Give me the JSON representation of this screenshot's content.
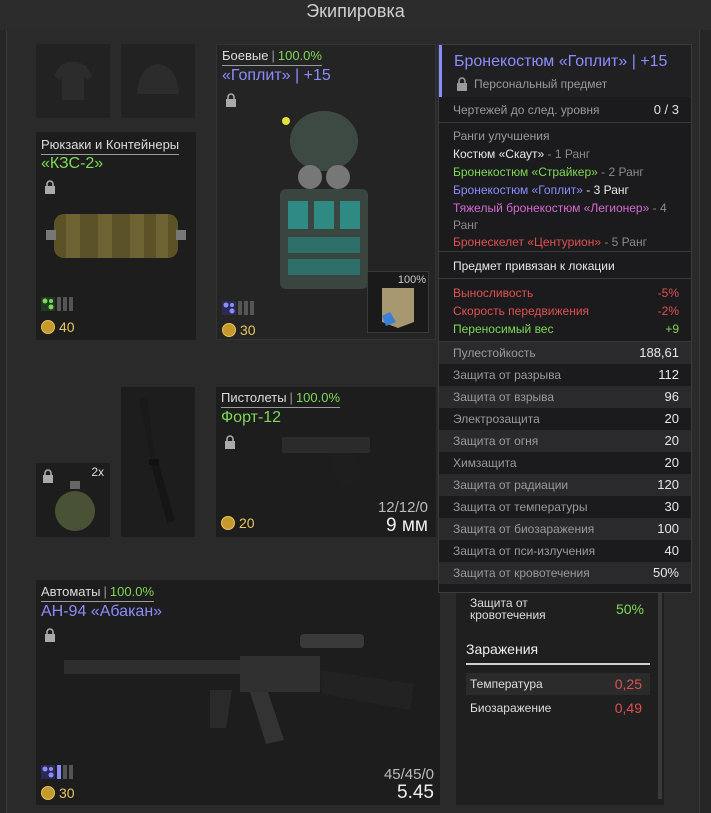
{
  "window": {
    "title": "Экипировка"
  },
  "slots": {
    "backpack": {
      "category": "Рюкзаки и Контейнеры",
      "name": "«КЗС-2»",
      "price": "40"
    },
    "armor": {
      "category": "Боевые",
      "condition": "100.0%",
      "name": "«Гоплит» | +15",
      "price": "30",
      "plate_durability": "100%"
    },
    "pistol": {
      "category": "Пистолеты",
      "condition": "100.0%",
      "name": "Форт-12",
      "price": "20",
      "ammo": "12/12/0",
      "caliber": "9 мм"
    },
    "grenade": {
      "count": "2x"
    },
    "rifle": {
      "category": "Автоматы",
      "condition": "100.0%",
      "name": "АН-94 «Абакан»",
      "price": "30",
      "ammo": "45/45/0",
      "caliber": "5.45"
    }
  },
  "tooltip": {
    "title": "Бронекостюм «Гоплит» | +15",
    "subtitle": "Персональный предмет",
    "blueprints_label": "Чертежей до след. уровня",
    "blueprints_value": "0 / 3",
    "ranks_header": "Ранги улучшения",
    "ranks": [
      {
        "name": "Костюм «Скаут»",
        "rank": " - 1 Ранг",
        "color": "#e8e8e8"
      },
      {
        "name": "Бронекостюм «Страйкер»",
        "rank": " - 2 Ранг",
        "color": "#7ed957"
      },
      {
        "name": "Бронекостюм «Гоплит»",
        "rank": " - 3 Ранг",
        "color": "#8c8cff"
      },
      {
        "name": "Тяжелый бронекостюм «Легионер»",
        "rank": " - 4 Ранг",
        "color": "#d36ad3"
      },
      {
        "name": "Бронескелет «Центурион»",
        "rank": " - 5 Ранг",
        "color": "#e05050"
      }
    ],
    "bound_note": "Предмет привязан к локации",
    "modifiers": [
      {
        "label": "Выносливость",
        "value": "-5%",
        "color": "#e05050"
      },
      {
        "label": "Скорость передвижения",
        "value": "-2%",
        "color": "#e05050"
      },
      {
        "label": "Переносимый вес",
        "value": "+9",
        "color": "#7ed957"
      }
    ],
    "stats": [
      {
        "label": "Пулестойкость",
        "value": "188,61"
      },
      {
        "label": "Защита от разрыва",
        "value": "112"
      },
      {
        "label": "Защита от взрыва",
        "value": "96"
      },
      {
        "label": "Электрозащита",
        "value": "20"
      },
      {
        "label": "Защита от огня",
        "value": "20"
      },
      {
        "label": "Химзащита",
        "value": "20"
      },
      {
        "label": "Защита от радиации",
        "value": "120"
      },
      {
        "label": "Защита от температуры",
        "value": "30"
      },
      {
        "label": "Защита от биозаражения",
        "value": "100"
      },
      {
        "label": "Защита от пси-излучения",
        "value": "40"
      },
      {
        "label": "Защита от кровотечения",
        "value": "50%"
      }
    ]
  },
  "right_panel": {
    "bleed_label": "Защита от кровотечения",
    "bleed_value": "50%",
    "infection_header": "Заражения",
    "infections": [
      {
        "label": "Температура",
        "value": "0,25"
      },
      {
        "label": "Биозаражение",
        "value": "0,49"
      }
    ]
  },
  "colors": {
    "accent_blue": "#8c8cff",
    "green": "#7ed957",
    "red": "#e05050",
    "gold": "#e6c860"
  }
}
